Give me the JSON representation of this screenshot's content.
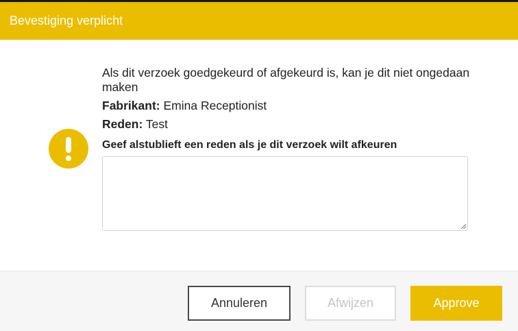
{
  "dialog": {
    "title": "Bevestiging verplicht",
    "message": "Als dit verzoek goedgekeurd of afgekeurd is, kan je dit niet ongedaan maken",
    "manufacturer_label": "Fabrikant:",
    "manufacturer_value": "Emina Receptionist",
    "reason_label": "Reden:",
    "reason_value": "Test",
    "reject_reason_prompt": "Geef alstublieft een reden als je dit verzoek wilt afkeuren",
    "reject_reason_value": "",
    "icon": "warning-icon"
  },
  "buttons": {
    "cancel": "Annuleren",
    "reject": "Afwijzen",
    "approve": "Approve"
  },
  "colors": {
    "accent": "#ebbd00",
    "disabled_text": "#c4c4c4"
  }
}
